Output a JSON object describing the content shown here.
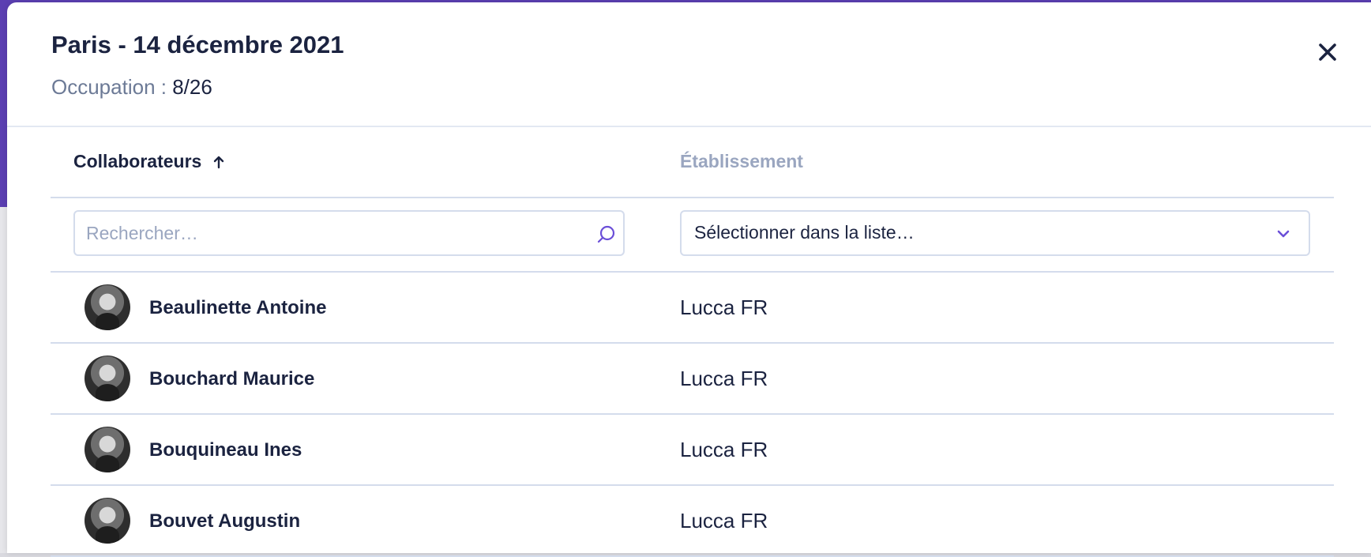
{
  "modal": {
    "title": "Paris - 14 décembre 2021",
    "occupation_label": "Occupation :",
    "occupation_value": "8/26",
    "close_icon": "close-icon"
  },
  "table": {
    "headers": {
      "collaborateurs": "Collaborateurs",
      "collaborateurs_sort": "ascending",
      "etablissement": "Établissement"
    },
    "filters": {
      "search_placeholder": "Rechercher…",
      "search_value": "",
      "select_value": "Sélectionner dans la liste…"
    },
    "rows": [
      {
        "name": "Beaulinette Antoine",
        "etablissement": "Lucca FR"
      },
      {
        "name": "Bouchard Maurice",
        "etablissement": "Lucca FR"
      },
      {
        "name": "Bouquineau Ines",
        "etablissement": "Lucca FR"
      },
      {
        "name": "Bouvet Augustin",
        "etablissement": "Lucca FR"
      }
    ]
  },
  "colors": {
    "accent": "#6b4fd8",
    "backdrop_top": "#5b3fb2",
    "text": "#1b2340",
    "muted": "#9aa6c0",
    "border": "#d4dcec"
  }
}
